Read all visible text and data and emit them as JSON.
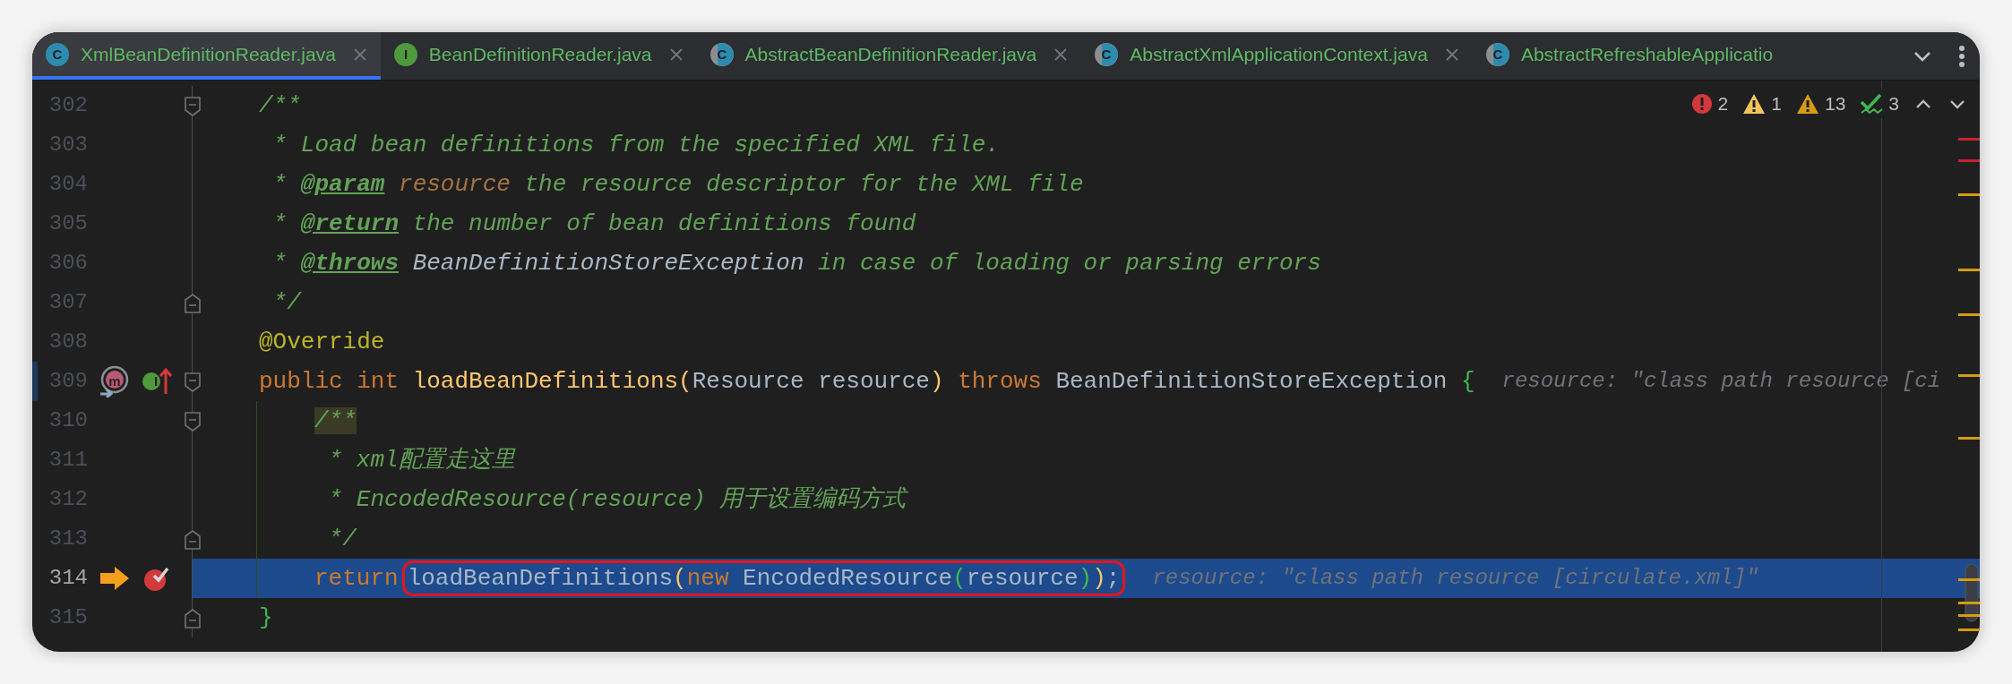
{
  "tabs": [
    {
      "label": "XmlBeanDefinitionReader.java",
      "icon": {
        "kind": "class",
        "letter": "C"
      },
      "selected": true,
      "closable": true
    },
    {
      "label": "BeanDefinitionReader.java",
      "icon": {
        "kind": "interface",
        "letter": "I"
      },
      "selected": false,
      "closable": true
    },
    {
      "label": "AbstractBeanDefinitionReader.java",
      "icon": {
        "kind": "abstract",
        "letter": "C"
      },
      "selected": false,
      "closable": true
    },
    {
      "label": "AbstractXmlApplicationContext.java",
      "icon": {
        "kind": "abstract",
        "letter": "C"
      },
      "selected": false,
      "closable": true
    },
    {
      "label": "AbstractRefreshableApplicatio",
      "icon": {
        "kind": "abstract",
        "letter": "C"
      },
      "selected": false,
      "closable": false
    }
  ],
  "inspections": [
    {
      "kind": "error",
      "count": "2"
    },
    {
      "kind": "warning",
      "count": "1"
    },
    {
      "kind": "weak_warning",
      "count": "13"
    },
    {
      "kind": "typo",
      "count": "3"
    }
  ],
  "lines": [
    {
      "number": "302",
      "current": false,
      "modified": false,
      "nested": false,
      "fold_marker": {
        "kind": "start"
      },
      "tokens": [
        {
          "kind": "comment",
          "text": "/**"
        }
      ]
    },
    {
      "number": "303",
      "current": false,
      "modified": false,
      "nested": false,
      "tokens": [
        {
          "kind": "comment",
          "text": " * Load bean definitions from the specified XML file."
        }
      ]
    },
    {
      "number": "304",
      "current": false,
      "modified": false,
      "nested": false,
      "tokens": [
        {
          "kind": "comment",
          "text": " * "
        },
        {
          "kind": "doc_tag",
          "text": "@param"
        },
        {
          "kind": "doc_param",
          "text": " resource"
        },
        {
          "kind": "comment",
          "text": " the resource descriptor for the XML file"
        }
      ]
    },
    {
      "number": "305",
      "current": false,
      "modified": false,
      "nested": false,
      "tokens": [
        {
          "kind": "comment",
          "text": " * "
        },
        {
          "kind": "doc_tag",
          "text": "@return"
        },
        {
          "kind": "comment",
          "text": " the number of bean definitions found"
        }
      ]
    },
    {
      "number": "306",
      "current": false,
      "modified": false,
      "nested": false,
      "tokens": [
        {
          "kind": "comment",
          "text": " * "
        },
        {
          "kind": "doc_tag",
          "text": "@throws"
        },
        {
          "kind": "doc_type",
          "text": " BeanDefinitionStoreException"
        },
        {
          "kind": "comment",
          "text": " in case of loading or parsing errors"
        }
      ]
    },
    {
      "number": "307",
      "current": false,
      "modified": false,
      "nested": false,
      "fold_marker": {
        "kind": "end"
      },
      "tokens": [
        {
          "kind": "comment",
          "text": " */"
        }
      ]
    },
    {
      "number": "308",
      "current": false,
      "modified": false,
      "nested": false,
      "tokens": [
        {
          "kind": "annotation",
          "text": "@Override"
        }
      ]
    },
    {
      "number": "309",
      "current": false,
      "modified": true,
      "nested": false,
      "fold_marker": {
        "kind": "start"
      },
      "gutter": [
        {
          "kind": "override",
          "letter": "m"
        },
        {
          "kind": "implements",
          "letter": "I"
        }
      ],
      "tokens": [
        {
          "kind": "keyword",
          "text": "public int "
        },
        {
          "kind": "method_decl",
          "text": "loadBeanDefinitions"
        },
        {
          "kind": "bracket1",
          "text": "("
        },
        {
          "kind": "plain",
          "text": "Resource resource"
        },
        {
          "kind": "bracket1",
          "text": ")"
        },
        {
          "kind": "keyword",
          "text": " throws "
        },
        {
          "kind": "plain",
          "text": "BeanDefinitionStoreException "
        },
        {
          "kind": "bracket2",
          "text": "{"
        }
      ],
      "hint": "resource: \"class path resource [ci"
    },
    {
      "number": "310",
      "current": false,
      "modified": false,
      "nested": true,
      "fold_marker": {
        "kind": "start"
      },
      "tokens": [
        {
          "kind": "comment_match",
          "text": "/**"
        }
      ]
    },
    {
      "number": "311",
      "current": false,
      "modified": false,
      "nested": true,
      "tokens": [
        {
          "kind": "comment",
          "text": " * xml配置走这里"
        }
      ]
    },
    {
      "number": "312",
      "current": false,
      "modified": false,
      "nested": true,
      "tokens": [
        {
          "kind": "comment",
          "text": " * EncodedResource(resource) 用于设置编码方式"
        }
      ]
    },
    {
      "number": "313",
      "current": false,
      "modified": false,
      "nested": true,
      "fold_marker": {
        "kind": "end"
      },
      "tokens": [
        {
          "kind": "comment",
          "text": " */"
        }
      ]
    },
    {
      "number": "314",
      "current": true,
      "modified": false,
      "nested": true,
      "gutter": [
        {
          "kind": "execution_point"
        },
        {
          "kind": "breakpoint"
        }
      ],
      "segments": [
        {
          "circled": false,
          "tokens": [
            {
              "kind": "keyword",
              "text": "return"
            }
          ]
        },
        {
          "circled": true,
          "tokens": [
            {
              "kind": "plain",
              "text": "loadBeanDefinitions"
            },
            {
              "kind": "bracket1",
              "text": "("
            },
            {
              "kind": "keyword",
              "text": "new"
            },
            {
              "kind": "plain",
              "text": " EncodedResource"
            },
            {
              "kind": "bracket2",
              "text": "("
            },
            {
              "kind": "plain",
              "text": "resource"
            },
            {
              "kind": "bracket2",
              "text": ")"
            },
            {
              "kind": "bracket1",
              "text": ")"
            },
            {
              "kind": "plain",
              "text": ";"
            }
          ]
        }
      ],
      "hint": "resource: \"class path resource [circulate.xml]\""
    },
    {
      "number": "315",
      "current": false,
      "modified": false,
      "nested": false,
      "fold_marker": {
        "kind": "end"
      },
      "tokens": [
        {
          "kind": "bracket2",
          "text": "}"
        }
      ]
    }
  ]
}
